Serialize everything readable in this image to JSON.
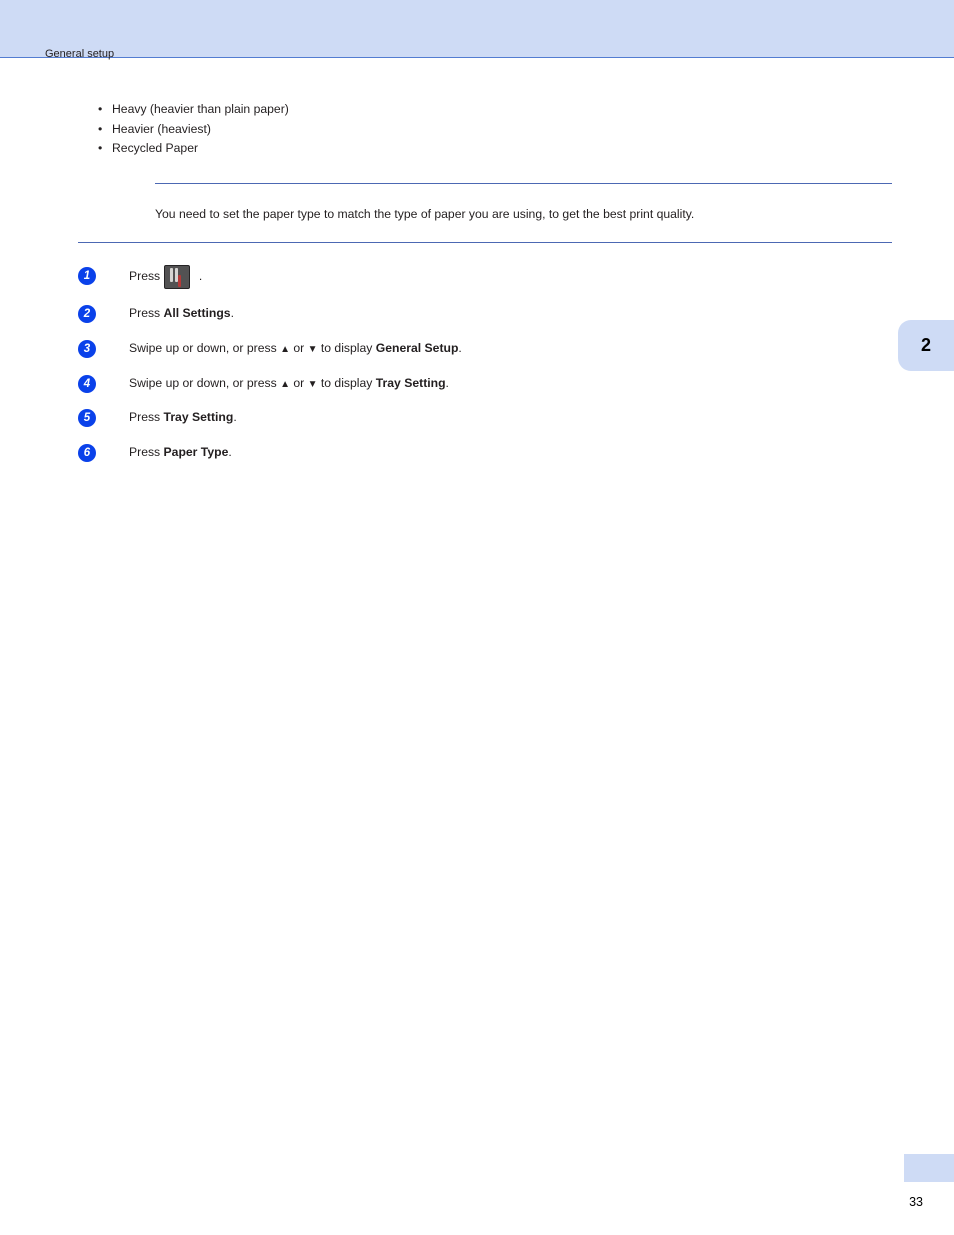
{
  "header": "General setup",
  "bullets": [
    {
      "text": "Heavy (heavier than plain paper)"
    },
    {
      "text": "Heavier (heaviest)"
    },
    {
      "text": "Recycled Paper"
    }
  ],
  "intro": "You need to set the paper type to match the type of paper you are using, to get the best print quality.",
  "steps": [
    {
      "num": "1",
      "pre": "Press ",
      "icon": true,
      "post": " ."
    },
    {
      "num": "2",
      "pre": "Press ",
      "bold": "All Settings",
      "post": "."
    },
    {
      "num": "3",
      "pre": "Swipe up or down, or press ",
      "mid": " to display ",
      "bold": "General Setup",
      "post": "."
    },
    {
      "num": "4",
      "pre": "Swipe up or down, or press ",
      "mid": " to display ",
      "bold": "Tray Setting",
      "post": "."
    },
    {
      "num": "5",
      "pre": "Press ",
      "bold": "Tray Setting",
      "post": "."
    },
    {
      "num": "6",
      "pre": "Press ",
      "bold": "Paper Type",
      "post": "."
    }
  ],
  "side_tab": "2",
  "page_number": "33",
  "arrows": {
    "up": "▲",
    "down": "▼",
    "or": " or "
  }
}
